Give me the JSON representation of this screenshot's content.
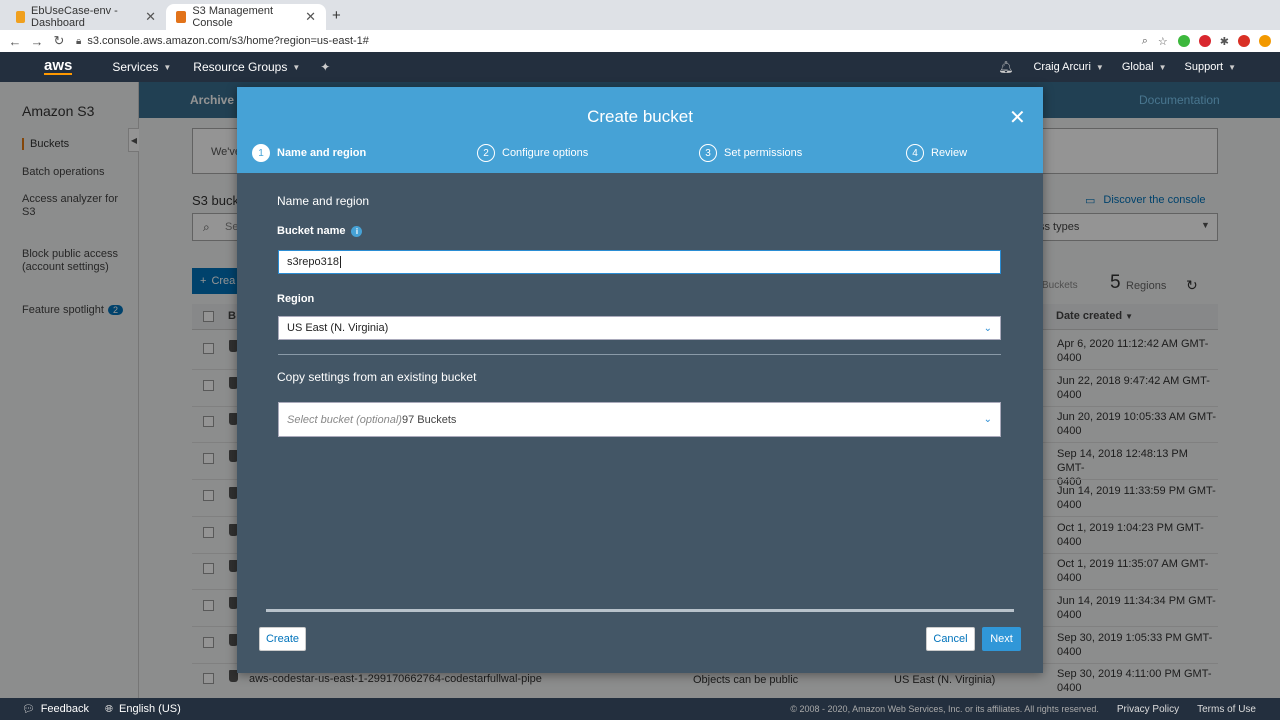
{
  "browser": {
    "tabs": [
      {
        "title": "EbUseCase-env - Dashboard",
        "favicon_color": "#f0a01e"
      },
      {
        "title": "S3 Management Console",
        "favicon_color": "#e2731a"
      }
    ],
    "new_tab": "+",
    "url": "s3.console.aws.amazon.com/s3/home?region=us-east-1#"
  },
  "aws_nav": {
    "logo": "aws",
    "services": "Services",
    "resource_groups": "Resource Groups",
    "user": "Craig Arcuri",
    "region": "Global",
    "support": "Support"
  },
  "sidebar": {
    "title": "Amazon S3",
    "items": [
      {
        "label": "Buckets"
      },
      {
        "label": "Batch operations"
      },
      {
        "label": "Access analyzer for S3"
      },
      {
        "label": "Block public access (account settings)"
      },
      {
        "label": "Feature spotlight",
        "badge": "2"
      }
    ]
  },
  "page": {
    "header_partial": "Archive",
    "documentation": "Documentation",
    "banner_partial": "We've",
    "section_partial": "S3 buck",
    "discover": "Discover the console",
    "search_partial": "Se",
    "access_types_partial": "ss types",
    "create_partial": "Crea",
    "buckets_label": "Buckets",
    "regions_count": "5",
    "regions_label": "Regions",
    "col_bucket_partial": "B",
    "date_created_header": "Date created",
    "dates": [
      [
        "Apr 6, 2020 11:12:42 AM GMT-",
        "0400"
      ],
      [
        "Jun 22, 2018 9:47:42 AM GMT-",
        "0400"
      ],
      [
        "Jun 20, 2019 10:05:33 AM GMT-",
        "0400"
      ],
      [
        "Sep 14, 2018 12:48:13 PM GMT-",
        "0400"
      ],
      [
        "Jun 14, 2019 11:33:59 PM GMT-",
        "0400"
      ],
      [
        "Oct 1, 2019 1:04:23 PM GMT-",
        "0400"
      ],
      [
        "Oct 1, 2019 11:35:07 AM GMT-",
        "0400"
      ],
      [
        "Jun 14, 2019 11:34:34 PM GMT-",
        "0400"
      ],
      [
        "Sep 30, 2019 1:05:33 PM GMT-",
        "0400"
      ],
      [
        "Sep 30, 2019 4:11:00 PM GMT-",
        "0400"
      ]
    ],
    "last_row": {
      "name": "aws-codestar-us-east-1-299170662764-codestarfullwal-pipe",
      "access": "Objects can be public",
      "region": "US East (N. Virginia)"
    }
  },
  "modal": {
    "title": "Create bucket",
    "steps": [
      {
        "num": "1",
        "label": "Name and region"
      },
      {
        "num": "2",
        "label": "Configure options"
      },
      {
        "num": "3",
        "label": "Set permissions"
      },
      {
        "num": "4",
        "label": "Review"
      }
    ],
    "section_title": "Name and region",
    "bucket_name_label": "Bucket name",
    "bucket_name_value": "s3repo318",
    "region_label": "Region",
    "region_value": "US East (N. Virginia)",
    "copy_title": "Copy settings from an existing bucket",
    "copy_placeholder": "Select bucket (optional)",
    "copy_count": "97 Buckets",
    "create_button": "Create",
    "cancel_button": "Cancel",
    "next_button": "Next"
  },
  "footer": {
    "feedback": "Feedback",
    "language": "English (US)",
    "copyright": "© 2008 - 2020, Amazon Web Services, Inc. or its affiliates. All rights reserved.",
    "privacy": "Privacy Policy",
    "terms": "Terms of Use"
  }
}
